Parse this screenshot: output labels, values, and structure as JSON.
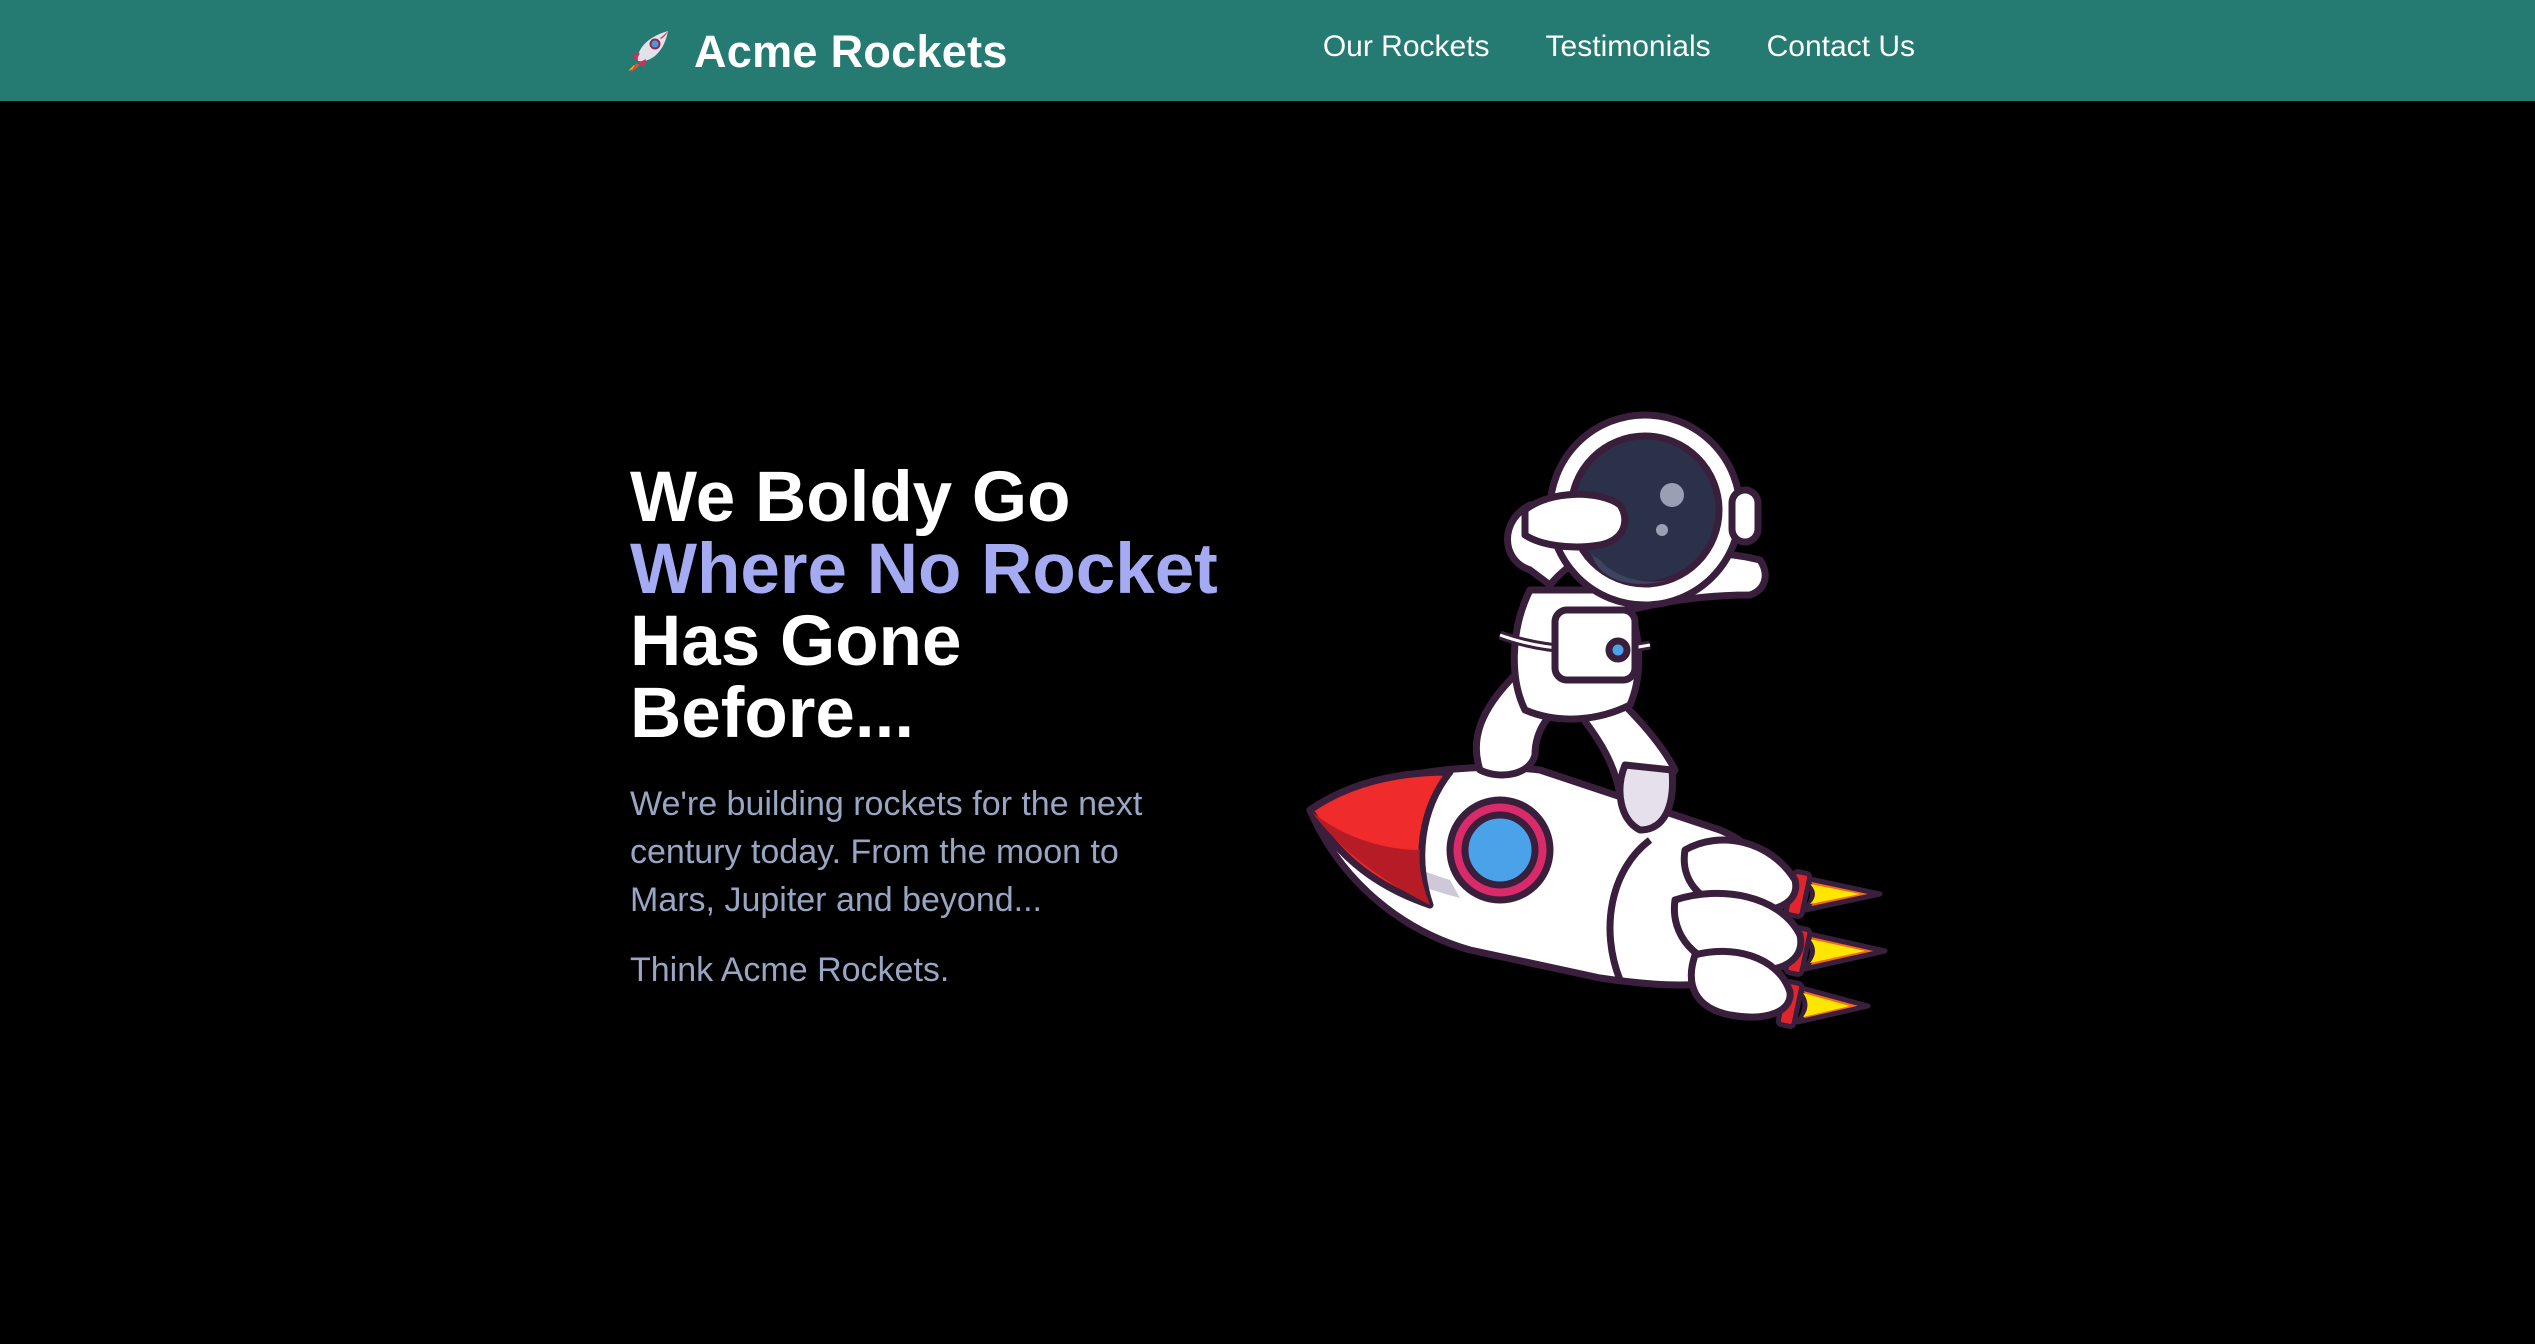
{
  "header": {
    "brand_name": "Acme Rockets",
    "brand_icon": "rocket-icon",
    "links": [
      {
        "label": "Our Rockets"
      },
      {
        "label": "Testimonials"
      },
      {
        "label": "Contact Us"
      }
    ]
  },
  "hero": {
    "heading_line1": "We Boldy Go",
    "heading_line2": "Where No Rocket",
    "heading_line3": "Has Gone",
    "heading_line4": "Before...",
    "paragraph": "We're building rockets for the next century today. From the moon to Mars, Jupiter and beyond...",
    "tagline": "Think Acme Rockets.",
    "illustration": "astronaut-on-rocket-illustration"
  },
  "colors": {
    "header_bg": "#257a72",
    "page_bg": "#000000",
    "heading_accent": "#a5abf2",
    "body_text": "#98a6c4"
  }
}
